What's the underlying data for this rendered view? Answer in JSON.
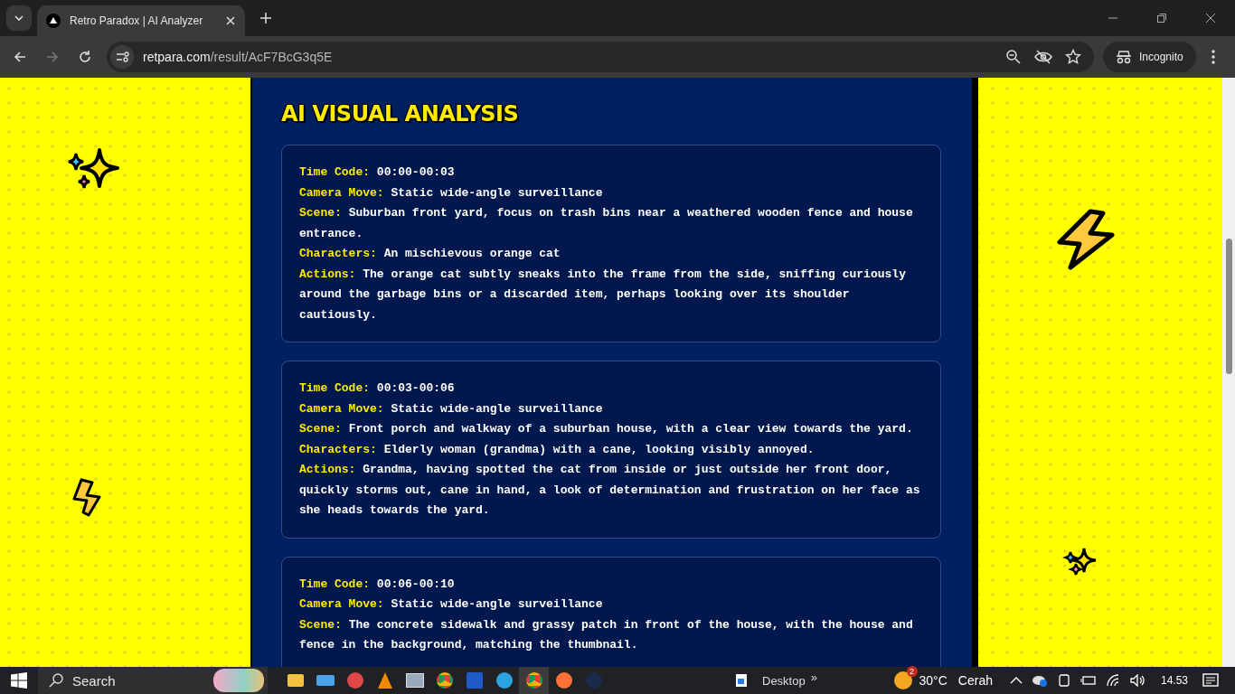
{
  "browser": {
    "tab": {
      "title": "Retro Paradox | AI Analyzer"
    },
    "address": {
      "host": "retpara.com",
      "path": "/result/AcF7BcG3q5E"
    },
    "profile": "Incognito"
  },
  "page": {
    "heading": "AI VISUAL ANALYSIS",
    "segments": [
      {
        "fields": [
          {
            "label": "Time Code:",
            "value": "00:00-00:03"
          },
          {
            "label": "Camera Move:",
            "value": "Static wide-angle surveillance"
          },
          {
            "label": "Scene:",
            "value": "Suburban front yard, focus on trash bins near a weathered wooden fence and house entrance."
          },
          {
            "label": "Characters:",
            "value": "An mischievous orange cat"
          },
          {
            "label": "Actions:",
            "value": "The orange cat subtly sneaks into the frame from the side, sniffing curiously around the garbage bins or a discarded item, perhaps looking over its shoulder cautiously."
          }
        ]
      },
      {
        "fields": [
          {
            "label": "Time Code:",
            "value": "00:03-00:06"
          },
          {
            "label": "Camera Move:",
            "value": "Static wide-angle surveillance"
          },
          {
            "label": "Scene:",
            "value": "Front porch and walkway of a suburban house, with a clear view towards the yard."
          },
          {
            "label": "Characters:",
            "value": "Elderly woman (grandma) with a cane, looking visibly annoyed."
          },
          {
            "label": "Actions:",
            "value": "Grandma, having spotted the cat from inside or just outside her front door, quickly storms out, cane in hand, a look of determination and frustration on her face as she heads towards the yard."
          }
        ]
      },
      {
        "fields": [
          {
            "label": "Time Code:",
            "value": "00:06-00:10"
          },
          {
            "label": "Camera Move:",
            "value": "Static wide-angle surveillance"
          },
          {
            "label": "Scene:",
            "value": "The concrete sidewalk and grassy patch in front of the house, with the house and fence in the background, matching the thumbnail."
          }
        ]
      }
    ]
  },
  "taskbar": {
    "search_placeholder": "Search",
    "desktop_label": "Desktop",
    "overflow": "»",
    "weather": {
      "badge": "2",
      "temperature": "30°C",
      "condition": "Cerah"
    },
    "clock": "14.53"
  }
}
